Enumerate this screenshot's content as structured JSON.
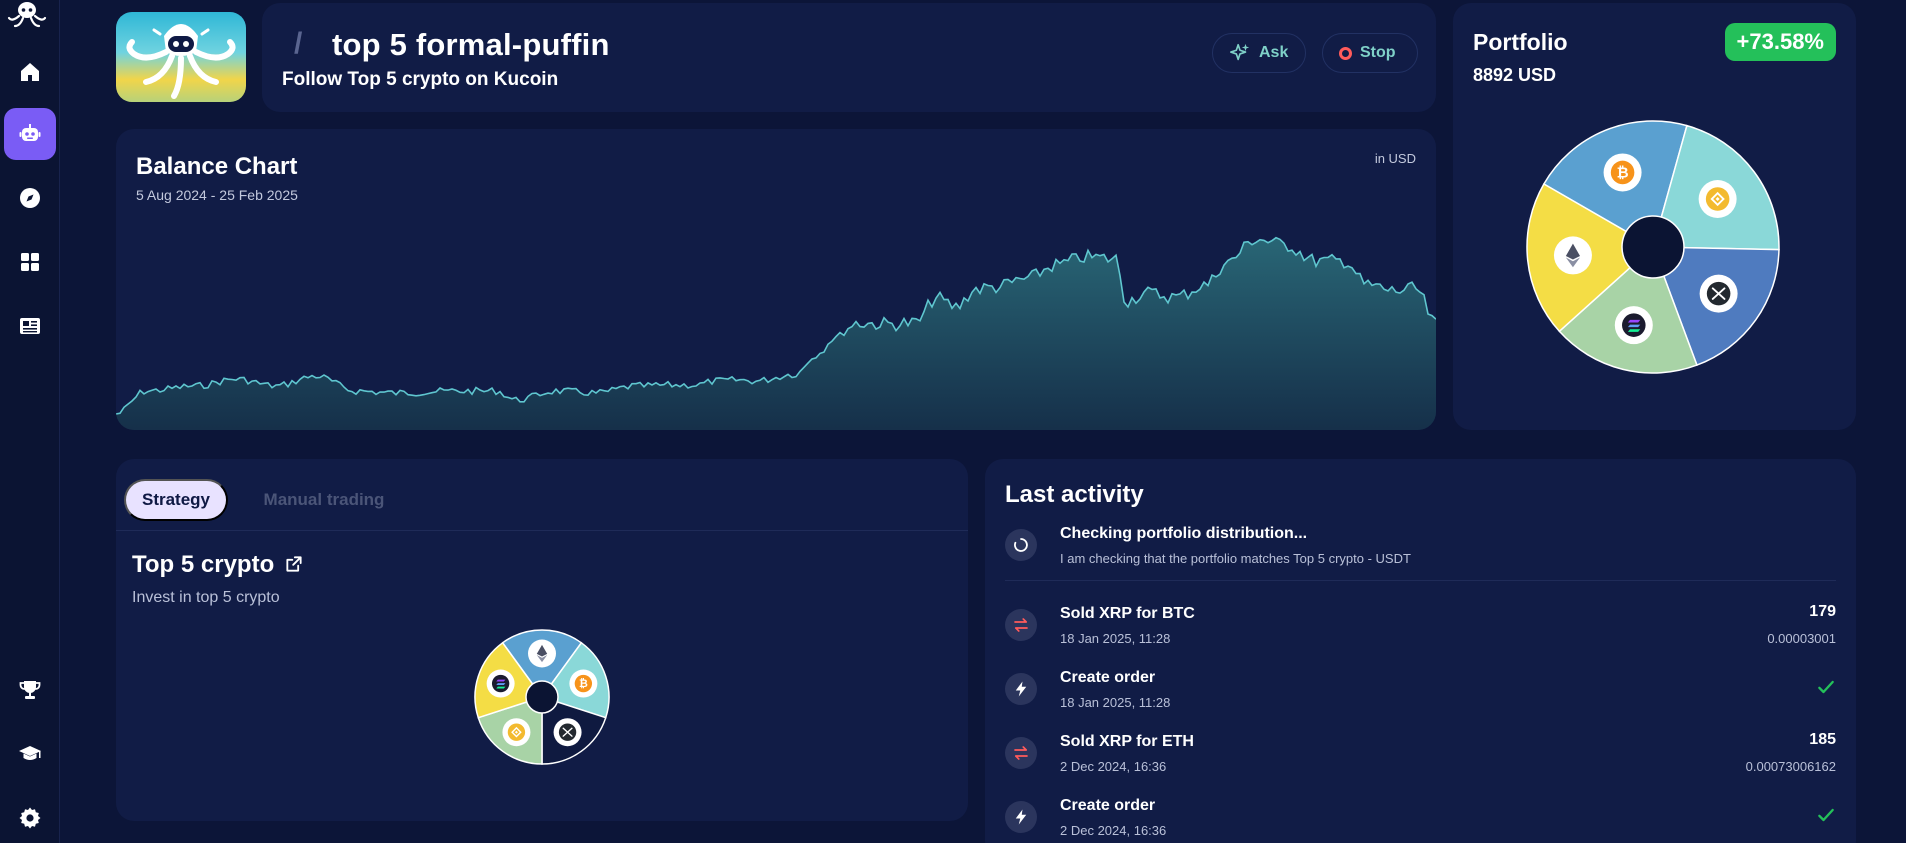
{
  "sidebar": {
    "items": [
      {
        "icon": "home-icon"
      },
      {
        "icon": "robot-icon",
        "active": true
      },
      {
        "icon": "compass-icon"
      },
      {
        "icon": "grid-icon"
      },
      {
        "icon": "news-icon"
      },
      {
        "icon": "trophy-icon"
      },
      {
        "icon": "graduation-cap-icon"
      },
      {
        "icon": "gear-icon"
      }
    ]
  },
  "header": {
    "slash": "/",
    "title": "top 5 formal-puffin",
    "subtitle": "Follow Top 5 crypto on Kucoin",
    "ask_label": "Ask",
    "stop_label": "Stop"
  },
  "portfolio": {
    "title": "Portfolio",
    "value": "8892 USD",
    "change": "+73.58%",
    "slices": [
      {
        "coin": "BTC",
        "color": "#5aa0d0",
        "share": 0.21
      },
      {
        "coin": "BNB",
        "color": "#8ad8d8",
        "share": 0.21
      },
      {
        "coin": "XRP",
        "color": "#4f7bbf",
        "share": 0.19
      },
      {
        "coin": "SOL",
        "color": "#a8d3a6",
        "share": 0.19
      },
      {
        "coin": "ETH",
        "color": "#f4dd45",
        "share": 0.2
      }
    ]
  },
  "balance_chart": {
    "title": "Balance Chart",
    "range": "5 Aug 2024 - 25 Feb 2025",
    "unit": "in USD",
    "line_color": "#5fc6cf",
    "fill_color": "#1f4f63"
  },
  "strategy": {
    "tabs": [
      {
        "label": "Strategy",
        "active": true
      },
      {
        "label": "Manual trading",
        "active": false
      }
    ],
    "title": "Top 5 crypto",
    "description": "Invest in top 5 crypto",
    "slices": [
      {
        "coin": "ETH",
        "color": "#5aa0d0"
      },
      {
        "coin": "BTC",
        "color": "#8ad8d8"
      },
      {
        "coin": "XRP",
        "color": "#0f1a40"
      },
      {
        "coin": "BNB",
        "color": "#a8d3a6"
      },
      {
        "coin": "SOL",
        "color": "#f4dd45"
      }
    ]
  },
  "activity": {
    "title": "Last activity",
    "pending": {
      "label": "Checking portfolio distribution...",
      "detail": "I am checking that the portfolio matches Top 5 crypto - USDT"
    },
    "items": [
      {
        "type": "swap",
        "label": "Sold XRP for BTC",
        "date": "18 Jan 2025, 11:28",
        "amount": "179",
        "sub": "0.00003001"
      },
      {
        "type": "order",
        "label": "Create order",
        "date": "18 Jan 2025, 11:28",
        "amount": "",
        "sub": ""
      },
      {
        "type": "swap",
        "label": "Sold XRP for ETH",
        "date": "2 Dec 2024, 16:36",
        "amount": "185",
        "sub": "0.00073006162"
      },
      {
        "type": "order",
        "label": "Create order",
        "date": "2 Dec 2024, 16:36",
        "amount": "",
        "sub": ""
      }
    ]
  }
}
